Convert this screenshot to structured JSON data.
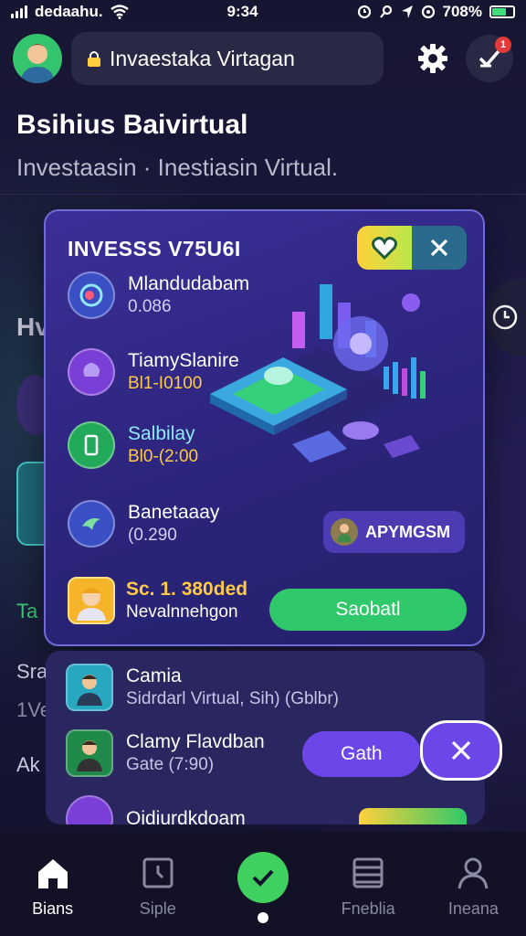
{
  "status_bar": {
    "carrier": "dedaahu.",
    "time": "9:34",
    "battery": "708%",
    "battery_level": 0.7
  },
  "header": {
    "search_text": "Invaestaka Virtagan",
    "notification_count": "1"
  },
  "page": {
    "title": "Bsihius Baivirtual",
    "subtitle": "Investaasin · Inestiasin Virtual."
  },
  "background": {
    "heading": "Hv",
    "row1": "Ta",
    "row2": "Sra",
    "row3": "1Ve",
    "row4": "Ak"
  },
  "card": {
    "title": "INVESSS V75U6I",
    "assets": [
      {
        "name": "Mlandudabam",
        "value": "0.086"
      },
      {
        "name": "TiamySlanire",
        "value": "Bl1-I0100"
      },
      {
        "name": "Salbilay",
        "value": "Bl0-(2:00"
      },
      {
        "name": "Banetaaay",
        "value": "(0.290"
      }
    ],
    "badge_button": "APYMGSM",
    "featured": {
      "amount": "Sc. 1. 380ded",
      "subtitle": "Nevalnnehgon"
    },
    "primary_button": "Saobatl"
  },
  "list": {
    "rows": [
      {
        "name": "Camia",
        "detail": "Sidrdarl Virtual, Sih) (Gblbr)"
      },
      {
        "name": "Clamy Flavdban",
        "detail": "Gate (7:90)"
      },
      {
        "name": "Oidjurdkdoam",
        "detail": ""
      }
    ],
    "action_button": "Gath"
  },
  "nav": {
    "items": [
      {
        "label": "Bians"
      },
      {
        "label": "Siple"
      },
      {
        "label": ""
      },
      {
        "label": "Fneblia"
      },
      {
        "label": "Ineana"
      }
    ]
  },
  "colors": {
    "accent_green": "#3fd05f",
    "accent_purple": "#6c46e8",
    "gold": "#ffc94a",
    "background": "#14132e"
  }
}
